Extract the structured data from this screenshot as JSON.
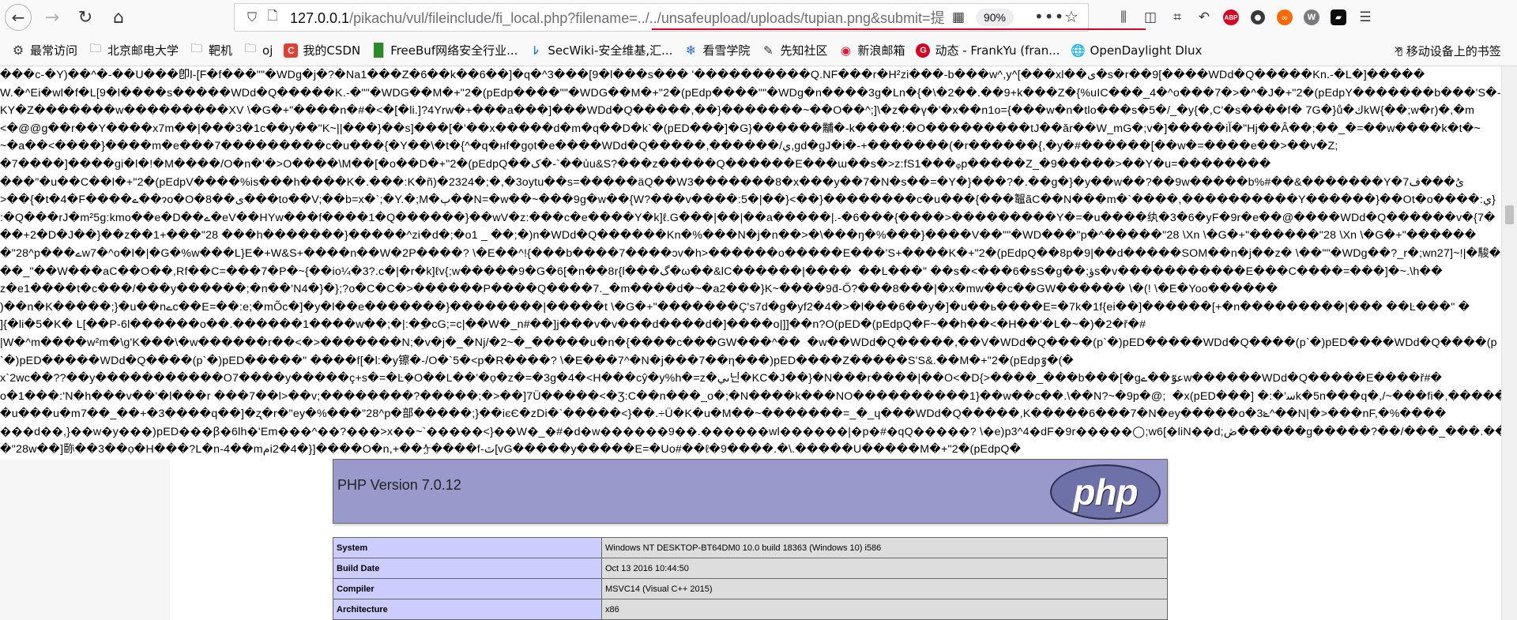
{
  "browser": {
    "url": {
      "host": "127.0.0.1",
      "path": "/pikachu/vul/fileinclude/fi_local.php?filename=../../unsafeupload/uploads/tupian.png&submit=提交"
    },
    "zoom": "90%"
  },
  "bookmarks": [
    {
      "label": "最常访问",
      "icon": "gear-icon"
    },
    {
      "label": "北京邮电大学",
      "icon": "folder-icon"
    },
    {
      "label": "靶机",
      "icon": "folder-icon"
    },
    {
      "label": "oj",
      "icon": "folder-icon"
    },
    {
      "label": "我的CSDN",
      "icon": "csdn-icon"
    },
    {
      "label": "FreeBuf网络安全行业...",
      "icon": "freebuf-icon"
    },
    {
      "label": "SecWiki-安全维基,汇...",
      "icon": "secwiki-icon"
    },
    {
      "label": "看雪学院",
      "icon": "kanxue-icon"
    },
    {
      "label": "先知社区",
      "icon": "xianzhi-icon"
    },
    {
      "label": "新浪邮箱",
      "icon": "weibo-icon"
    },
    {
      "label": "动态 - FrankYu (fran...",
      "icon": "dongtai-icon"
    },
    {
      "label": "OpenDaylight Dlux",
      "icon": "globe-icon"
    }
  ],
  "bookmarks_mobile": "移动设备上的书签",
  "garbled_lines": [
    "���c-�Y)��^�-��U���卽l-[F�f���\"\"�WDg�j�?�Na1���Z�6��k��6��]�q�^3���[9�l���s��� '����������Q.NF���r�H²zi���-b���w^,y^[���xl��ى�s�r��9[����WDd�Q�����Kn.-�L�]�����",
    "W.�^Ei�wl�f�L[9�l����s�����WDd�Q�����K.-�\"\"�WDG��M�+\"2�(pEdp����\"\"�WDG��M�+\"2�(pEdp����\"\"�WDg�n����3g�Ln�{�\\�2��.��9+k���Z�{%uIC���_4�^o���7�>�^�J�+\"2�(pEdpY�������b���'S�-",
    "KY�Z�������w���������XV \\�G�+\"����n�#�<�[�li.]?4Yrw�+���a���]���WDd�Q�����,��}�������~��O��^;]\\�z��ү�'�x��n1o={���w�n�tlo���s�5�/_�y{�,C'�s����f� 7G�}ů�كkW{��;w�r)�,�m",
    "<�@@g��r��Y����x7m��|���3�1c��y��\"K~||���}��s]���[�'��x�����d�m�q��D�k`�(pED���]�G}������黼�-k����؛�O���������tJ��ăr��W_mG�;v�]�����iآ�\"Hj��Â��;��_�=��w����k�t�~",
    "~�a��<����}����m�e���7���������c�u���{�Y��\\�t�{^�q�нf�gọt�e����WDd�Q�����,������/ي,gd�gJ�i�-+�������(�r������{,�y�#������[��w�=����e��>��v�Z;",
    "�7����]����gi�l�!�M����/O�n�'�>O����\\M��[�o��D�+\"2�(pEdpQ��ک�-`��ủu&S?���z�����Q������E���ɯ��s�>z:fS1���ᵩp�����Z_�9�����>��Y�u=��������",
    "���\"�u��C��l�+\"2�(pEdpV����%is���h����K�.���:K�ñ)�2324�;�,�3oytu��s=�����äQ��W3�������8�x���y��7�N�s��=�Y�}���?�.��g�}�y��w��?��9w�����b%#��&�������Y�7ىُ���ف",
    ">��{�t�4�F����ے��ɂo�O�8��ی���to��V;��b=x�`;�Y.�;M�ٻ��N=�w��~���9g�w��{W?���v����:5�|��}<��}��������c�u���{���鼅ãC��N���m�`����,����������Y������}��Ot�o����:ي}",
    ":�Q���rJ�m²5g:kmo��e�D��ے�eV��HYw���f����1�Q������}��wV�z:���c�e����Y�k]ℓ.G���|��|��a�����|.-�6���{����>���������Y�=�u����纨�3�6�yF�9r�e��@����WDd�Q������v�{7�",
    "��+2�D�J��}��z��1+���\"28 ���h�������}�����^zi�d�;�o1 _ ��;�)n�WDd�Q������Kn�%���N�j�n��>�\\���ŋ�%���}����V��\"\"�WD���\"p�^�����\"28 \\Xn \\�G�+\"������\"28 \\Xn \\�G�+\"������",
    "�\"28^p���ےw7�^o�l�|�G�%w���L}E�+W&S+����n��W�2P����? \\�E��^!{���b����7����ɔv�h>������o�����E���'S+����K�+\"2�(pEdpQ��8p�9|��d�����SOM��n�j��z� \\��\"\"�WDg��?_r�;wn27]~!|�駿�",
    "��_\"��W���aC��O��,Rf��C=���7�P�~{��io¼�3?.c�|�r�k]ℓv{;w�����9�G�6[�n��8r{l���گ�ω��&lC������|����  ��L���\" ��s�<���6�ꞩS�g��;ؤs�v�����������E���C����=���]�~.\\h��",
    "z�e1����t�c���/���y������;�n��'N4�}�};?o�C�C�>������P����Q����7._�m����d�~�a2���}K~����9d̄-Ő?���8���|�x�mw��c��GW������ \\�(! \\�E�Yoo������",
    ")��n�K�����;}�u��nےc��E=��:e;�mÕc�]�y�l��e�������}��������|�����t \\�G�+\"�������Ç's7d�g�yf2�4�>�l���6��y�]�u��ь����E=�7k�1f{ei��]������[+�n���������|��� ��Ŀ���\" �",
    "]{�li�5�K� L[��P-6l������o��.������1����w��;�|:��ِcG;=c|��W�_n#��]j���v�v���d����d�]����o|]]��n?O(pED�(pEdpQ�F~��h��<�H��'�L�~�)�2�ř�#",
    "|W�^m����w²m�\\g'K���\\�w������r��<�>�������N;�v�j�_�Nj/�2~�_�����u�n�{����c���GW���^��  �w��WDd�Q�����,��V�WDd�Q����(p`�)pED�����WDd�Q����(p`�)pED����WDd�Q����(p",
    "`�)pED�����WDd�Q����(p`�)pED�����\" ����f[�l:�y镲�-/O�`5�<p�R����? \\�E���7^�N�j���7��η���)pED����Z�����S'S&.��M�+\"2�(pEdpٷ�(�",
    "x`2wc��??��y�����������O7����y�����ç+s�=�Ŀ݂�O��L��'�ọ�z�=�3g�4�<H���cŷ�y%h�=z�ىي닌�KC�J��}�N���r����|��O<�D{>����_���b���[�gعٷ��ےw������WDd�Q�����E����ř#�",
    "o�1���:'N�h���v��'�l���r ���7��l>��v;��������?�����;�>��]7Ü�����<�Ʒ:C��n���_o�;�N����k���NO����������1}��w��c��.\\��N?~�9p�@;  �x(pED���] �:�'ﺳk�5n���q�,/~���fi�,��������-",
    "�u���u�m7��_��+�3����q��]�ʐ�r�\"ey�%���\"28^p�部�����;}��iєЄ�zDi�`�����<}��.÷Ü�K�u�M��~�������=_�_ɥ���WDd�Q�����,K�����6���7�N�ey�����o�3ݺ^��N|�>���nF,�%����",
    "���d��,}��w�y���)pED���ꞵ�6lh�'Em���^��?���>x��~`�����<}��W�_�#�d�w������9��.������wl������|�p�#�qQ�����? \\�e)p3^4�dF�9r�����◯;w6[�liN��d;ڞ������g�����?��/���_���.����",
    "�\"28w��]䑐��3��ọ�H���?L�n-4��mمi2�4�}]����O�n,+��ᢢ����f-ٿ[vG�����y�����E=�Uo#��ℓ�9����.�\\.�����U�����M�+\"2�(pEdpQ�"
  ],
  "phpinfo": {
    "version": "PHP Version 7.0.12",
    "logo_text": "php",
    "rows": [
      {
        "key": "System",
        "value": "Windows NT DESKTOP-BT64DM0 10.0 build 18363 (Windows 10) i586"
      },
      {
        "key": "Build Date",
        "value": "Oct 13 2016 10:44:50"
      },
      {
        "key": "Compiler",
        "value": "MSVC14 (Visual C++ 2015)"
      },
      {
        "key": "Architecture",
        "value": "x86"
      }
    ]
  },
  "colors": {
    "url_underline": "#d70022",
    "php_header": "#9999cc",
    "table_key": "#ccccff",
    "table_value": "#dddddd"
  }
}
